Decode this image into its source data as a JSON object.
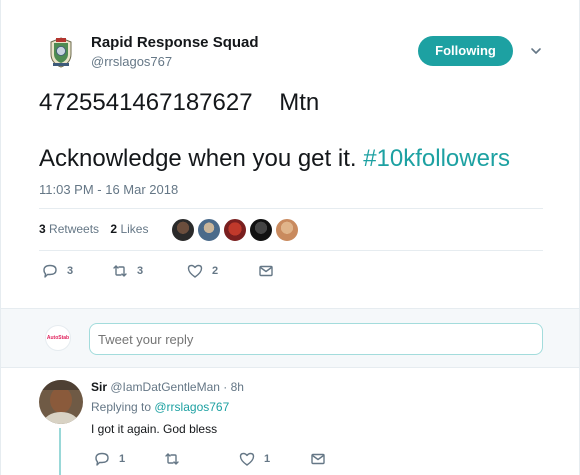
{
  "tweet": {
    "author_name": "Rapid Response Squad",
    "author_handle": "@rrslagos767",
    "follow_label": "Following",
    "text_line1": "4725541467187627    Mtn",
    "text_line2": "Acknowledge when you get it. ",
    "hashtag": "#10kfollowers",
    "timestamp": "11:03 PM - 16 Mar 2018",
    "retweets_count": "3",
    "retweets_label": "Retweets",
    "likes_count": "2",
    "likes_label": "Likes",
    "actions": {
      "reply_count": "3",
      "retweet_count": "3",
      "like_count": "2"
    }
  },
  "reply_box": {
    "placeholder": "Tweet your reply",
    "avatar_text": "AutoStab"
  },
  "reply": {
    "name": "Sir",
    "handle": "@IamDatGentleMan",
    "separator": " · ",
    "time": "8h",
    "replying_prefix": "Replying to ",
    "replying_to": "@rrslagos767",
    "text": "I got it again. God bless",
    "actions": {
      "reply_count": "1",
      "retweet_count": "",
      "like_count": "1"
    }
  },
  "colors": {
    "accent": "#1da1a2",
    "muted": "#657786",
    "text": "#14171a",
    "border": "#e6ecf0"
  }
}
